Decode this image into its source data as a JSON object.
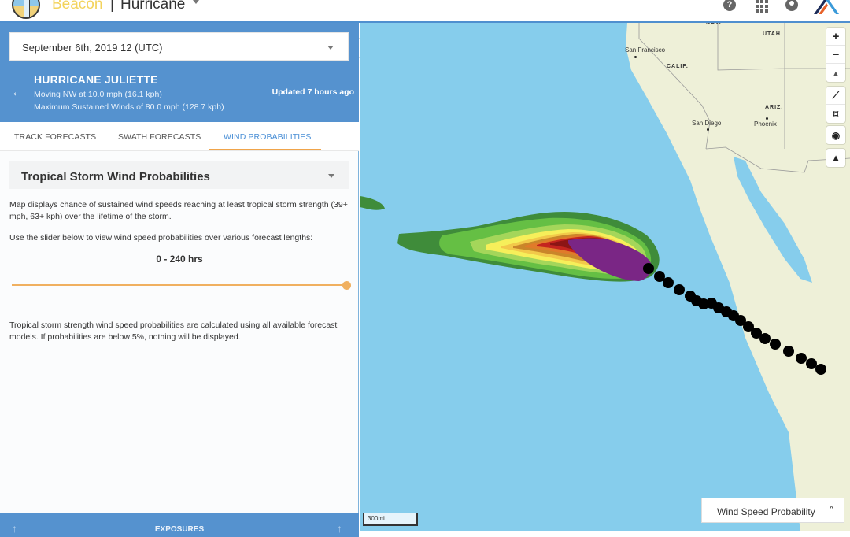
{
  "app": {
    "brand": "Beacon",
    "separator": "|",
    "product": "Hurricane",
    "top_icons": [
      "help-icon",
      "apps-grid-icon",
      "user-account-icon",
      "company-logo"
    ]
  },
  "sidebar": {
    "date_select": {
      "value": "September 6th, 2019 12 (UTC)"
    },
    "storm": {
      "name": "HURRICANE JULIETTE",
      "movement": "Moving NW at 10.0 mph (16.1 kph)",
      "max_winds": "Maximum Sustained Winds of 80.0 mph (128.7 kph)",
      "updated": "Updated 7 hours ago"
    },
    "tabs": [
      {
        "label": "TRACK FORECASTS",
        "active": false
      },
      {
        "label": "SWATH FORECASTS",
        "active": false
      },
      {
        "label": "WIND PROBABILITIES",
        "active": true
      }
    ],
    "panel": {
      "select_value": "Tropical Storm Wind Probabilities",
      "description": "Map displays chance of sustained wind speeds reaching at least tropical storm strength (39+ mph, 63+ kph) over the lifetime of the storm.",
      "slider_hint": "Use the slider below to view wind speed probabilities over various forecast lengths:",
      "range_label": "0 - 240 hrs",
      "slider_value_fraction": 1.0,
      "footnote": "Tropical storm strength wind speed probabilities are calculated using all available forecast models. If probabilities are below 5%, nothing will be displayed."
    },
    "exposures_label": "EXPOSURES"
  },
  "map": {
    "labels": {
      "nev": "NEV.",
      "utah": "UTAH",
      "calif": "CALIF.",
      "ariz": "ARIZ.",
      "san_francisco": "San Francisco",
      "san_diego": "San Diego",
      "phoenix": "Phoenix"
    },
    "controls": {
      "zoom_in": "+",
      "zoom_out": "−",
      "compass": "▲",
      "measure": "⟋",
      "select_area": "⌑",
      "camera": "◉",
      "warning": "▲"
    },
    "scale_label": "300mi",
    "legend_button": "Wind Speed Probability",
    "legend_chevron": "^",
    "colors": {
      "ocean": "#86cdec",
      "land": "#eef0d8",
      "prob_5": "#3f8c3a",
      "prob_10": "#65bf44",
      "prob_20": "#a4d65a",
      "prob_30": "#f6ef5a",
      "prob_40": "#f2c94a",
      "prob_50": "#c9862a",
      "prob_60": "#e07b2a",
      "prob_70": "#c4241f",
      "prob_80": "#8c1515",
      "prob_90": "#7a2685",
      "track": "#000000"
    }
  }
}
